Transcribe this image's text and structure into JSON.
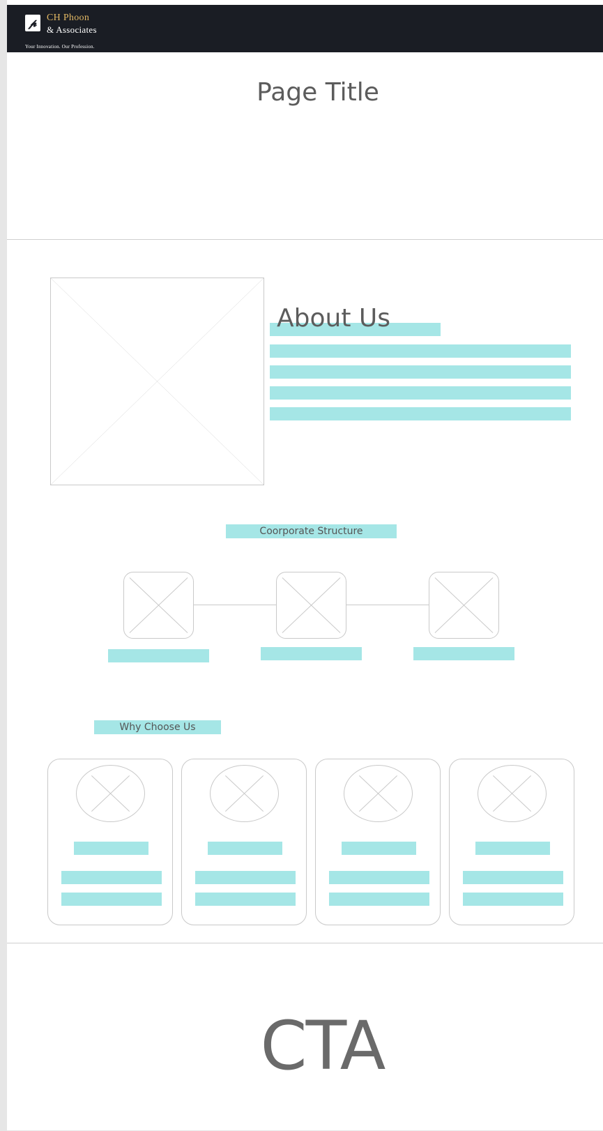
{
  "header": {
    "logo_mark": "𝓹",
    "logo_line1": "CH Phoon",
    "logo_line2": "& Associates",
    "tagline": "Your Innovation. Our Profession."
  },
  "hero": {
    "title": "Page Title"
  },
  "about": {
    "title": "About Us",
    "image_icon": "image-placeholder-icon"
  },
  "structure": {
    "label": "Coorporate Structure",
    "nodes": 3
  },
  "why": {
    "label": "Why Choose Us",
    "cards": 4
  },
  "cta": {
    "label": "CTA"
  },
  "colors": {
    "header_bg": "#1a1d24",
    "accent_gold": "#e3b964",
    "placeholder_bar": "#a5e6e6",
    "outline": "#c9c9c9",
    "text": "#5c5c5c"
  }
}
